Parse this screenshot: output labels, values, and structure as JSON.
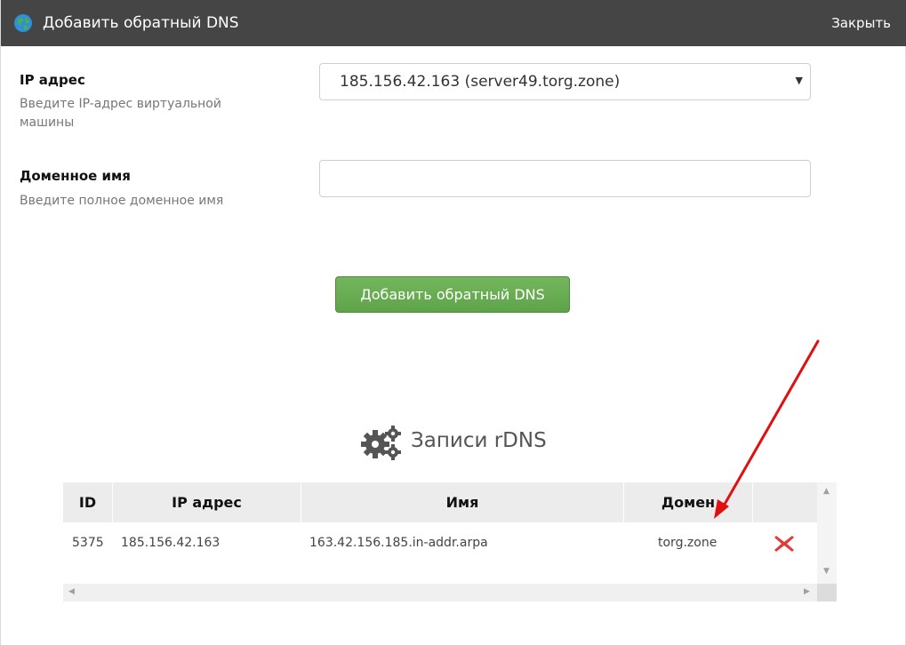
{
  "dialog": {
    "title": "Добавить обратный DNS",
    "close_label": "Закрыть"
  },
  "form": {
    "ip": {
      "label": "IP адрес",
      "hint": "Введите IP-адрес виртуальной машины",
      "selected_value": "185.156.42.163 (server49.torg.zone)"
    },
    "domain": {
      "label": "Доменное имя",
      "hint": "Введите полное доменное имя",
      "value": ""
    },
    "submit_label": "Добавить обратный DNS"
  },
  "records": {
    "title": "Записи rDNS",
    "columns": [
      "ID",
      "IP адрес",
      "Имя",
      "Домен",
      ""
    ],
    "rows": [
      {
        "id": "5375",
        "ip": "185.156.42.163",
        "name": "163.42.156.185.in-addr.arpa",
        "domain": "torg.zone"
      }
    ]
  },
  "colors": {
    "titlebar": "#454545",
    "button_green": "#5ea34a",
    "delete_red": "#e23b3b",
    "annotation_arrow": "#e01010"
  },
  "icons": [
    "globe-icon",
    "gears-icon",
    "delete-icon",
    "chevron-down-icon"
  ]
}
